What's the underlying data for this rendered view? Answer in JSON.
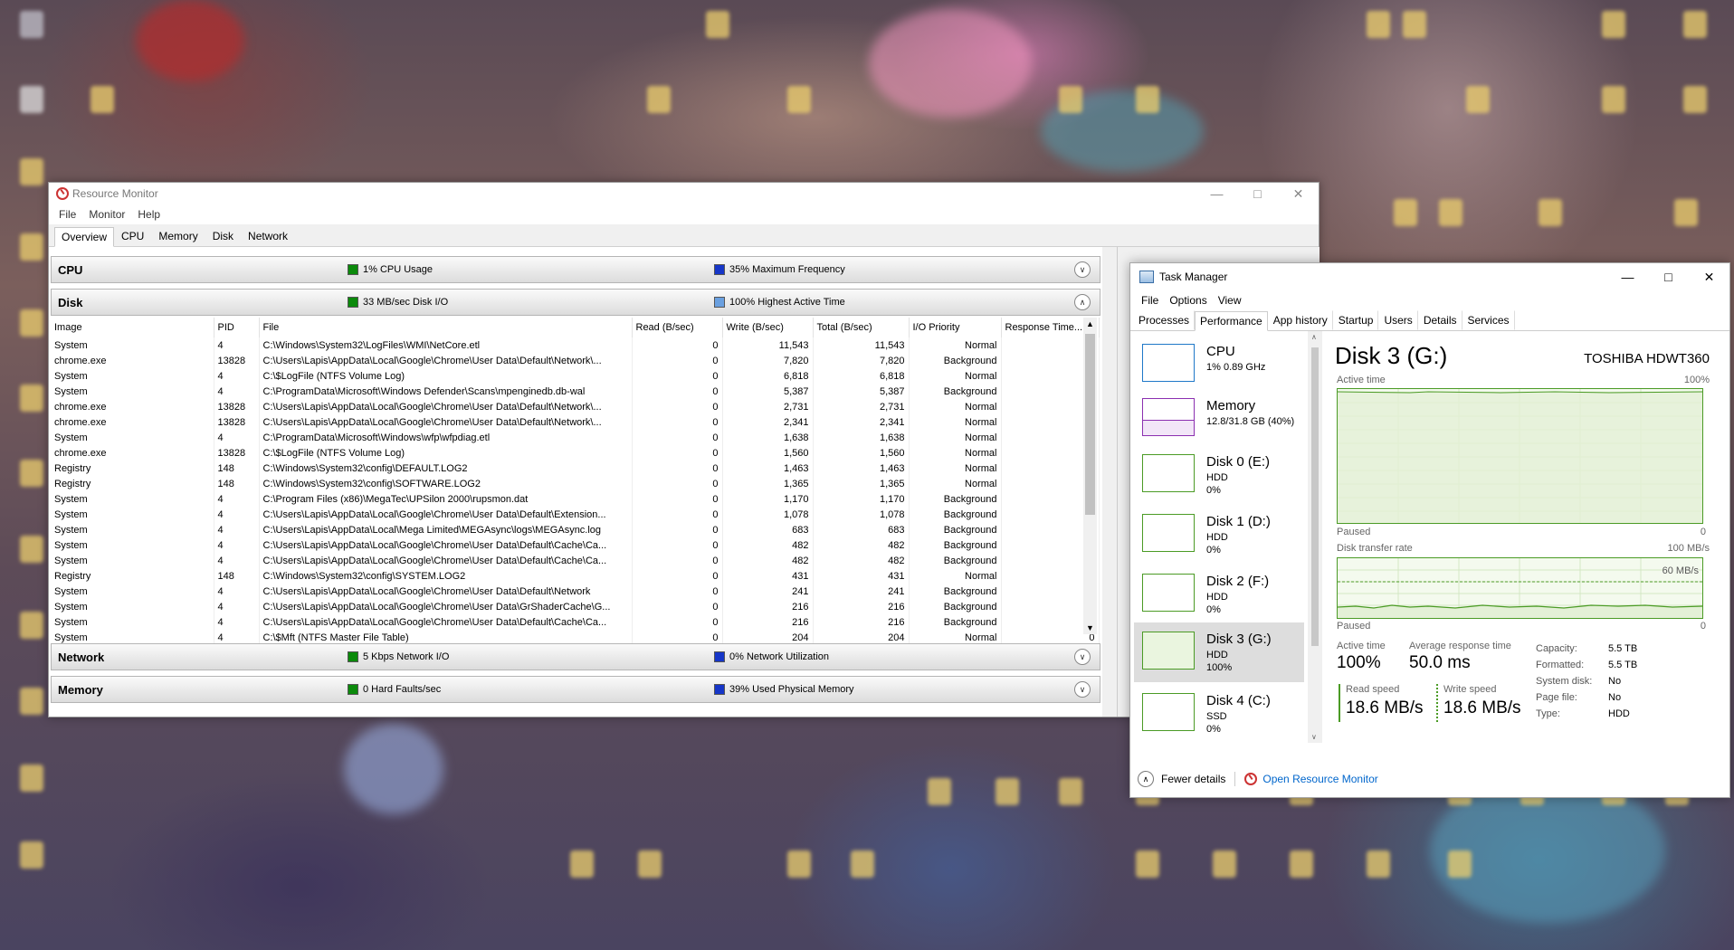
{
  "resmon": {
    "title": "Resource Monitor",
    "menu": [
      "File",
      "Monitor",
      "Help"
    ],
    "tabs": [
      "Overview",
      "CPU",
      "Memory",
      "Disk",
      "Network"
    ],
    "cpu": {
      "name": "CPU",
      "legend1": "1% CPU Usage",
      "legend2": "35% Maximum Frequency"
    },
    "disk": {
      "name": "Disk",
      "legend1": "33 MB/sec Disk I/O",
      "legend2": "100% Highest Active Time"
    },
    "network": {
      "name": "Network",
      "legend1": "5 Kbps Network I/O",
      "legend2": "0% Network Utilization"
    },
    "memory": {
      "name": "Memory",
      "legend1": "0 Hard Faults/sec",
      "legend2": "39% Used Physical Memory"
    },
    "disk_table": {
      "columns": [
        "Image",
        "PID",
        "File",
        "Read (B/sec)",
        "Write (B/sec)",
        "Total (B/sec)",
        "I/O Priority",
        "Response Time..."
      ],
      "rows": [
        [
          "System",
          "4",
          "C:\\Windows\\System32\\LogFiles\\WMI\\NetCore.etl",
          "0",
          "11,543",
          "11,543",
          "Normal",
          "0"
        ],
        [
          "chrome.exe",
          "13828",
          "C:\\Users\\Lapis\\AppData\\Local\\Google\\Chrome\\User Data\\Default\\Network\\...",
          "0",
          "7,820",
          "7,820",
          "Background",
          "0"
        ],
        [
          "System",
          "4",
          "C:\\$LogFile (NTFS Volume Log)",
          "0",
          "6,818",
          "6,818",
          "Normal",
          "0"
        ],
        [
          "System",
          "4",
          "C:\\ProgramData\\Microsoft\\Windows Defender\\Scans\\mpenginedb.db-wal",
          "0",
          "5,387",
          "5,387",
          "Background",
          "0"
        ],
        [
          "chrome.exe",
          "13828",
          "C:\\Users\\Lapis\\AppData\\Local\\Google\\Chrome\\User Data\\Default\\Network\\...",
          "0",
          "2,731",
          "2,731",
          "Normal",
          "0"
        ],
        [
          "chrome.exe",
          "13828",
          "C:\\Users\\Lapis\\AppData\\Local\\Google\\Chrome\\User Data\\Default\\Network\\...",
          "0",
          "2,341",
          "2,341",
          "Normal",
          "0"
        ],
        [
          "System",
          "4",
          "C:\\ProgramData\\Microsoft\\Windows\\wfp\\wfpdiag.etl",
          "0",
          "1,638",
          "1,638",
          "Normal",
          "0"
        ],
        [
          "chrome.exe",
          "13828",
          "C:\\$LogFile (NTFS Volume Log)",
          "0",
          "1,560",
          "1,560",
          "Normal",
          "0"
        ],
        [
          "Registry",
          "148",
          "C:\\Windows\\System32\\config\\DEFAULT.LOG2",
          "0",
          "1,463",
          "1,463",
          "Normal",
          "0"
        ],
        [
          "Registry",
          "148",
          "C:\\Windows\\System32\\config\\SOFTWARE.LOG2",
          "0",
          "1,365",
          "1,365",
          "Normal",
          "0"
        ],
        [
          "System",
          "4",
          "C:\\Program Files (x86)\\MegaTec\\UPSilon 2000\\rupsmon.dat",
          "0",
          "1,170",
          "1,170",
          "Background",
          "0"
        ],
        [
          "System",
          "4",
          "C:\\Users\\Lapis\\AppData\\Local\\Google\\Chrome\\User Data\\Default\\Extension...",
          "0",
          "1,078",
          "1,078",
          "Background",
          "0"
        ],
        [
          "System",
          "4",
          "C:\\Users\\Lapis\\AppData\\Local\\Mega Limited\\MEGAsync\\logs\\MEGAsync.log",
          "0",
          "683",
          "683",
          "Background",
          "1"
        ],
        [
          "System",
          "4",
          "C:\\Users\\Lapis\\AppData\\Local\\Google\\Chrome\\User Data\\Default\\Cache\\Ca...",
          "0",
          "482",
          "482",
          "Background",
          "0"
        ],
        [
          "System",
          "4",
          "C:\\Users\\Lapis\\AppData\\Local\\Google\\Chrome\\User Data\\Default\\Cache\\Ca...",
          "0",
          "482",
          "482",
          "Background",
          "0"
        ],
        [
          "Registry",
          "148",
          "C:\\Windows\\System32\\config\\SYSTEM.LOG2",
          "0",
          "431",
          "431",
          "Normal",
          "0"
        ],
        [
          "System",
          "4",
          "C:\\Users\\Lapis\\AppData\\Local\\Google\\Chrome\\User Data\\Default\\Network",
          "0",
          "241",
          "241",
          "Background",
          "0"
        ],
        [
          "System",
          "4",
          "C:\\Users\\Lapis\\AppData\\Local\\Google\\Chrome\\User Data\\GrShaderCache\\G...",
          "0",
          "216",
          "216",
          "Background",
          "0"
        ],
        [
          "System",
          "4",
          "C:\\Users\\Lapis\\AppData\\Local\\Google\\Chrome\\User Data\\Default\\Cache\\Ca...",
          "0",
          "216",
          "216",
          "Background",
          "0"
        ],
        [
          "System",
          "4",
          "C:\\$Mft (NTFS Master File Table)",
          "0",
          "204",
          "204",
          "Normal",
          "0"
        ]
      ]
    }
  },
  "taskmgr": {
    "title": "Task Manager",
    "menu": [
      "File",
      "Options",
      "View"
    ],
    "tabs": [
      "Processes",
      "Performance",
      "App history",
      "Startup",
      "Users",
      "Details",
      "Services"
    ],
    "items": [
      {
        "name": "CPU",
        "sub1": "1% 0.89 GHz",
        "sub2": ""
      },
      {
        "name": "Memory",
        "sub1": "12.8/31.8 GB (40%)",
        "sub2": ""
      },
      {
        "name": "Disk 0 (E:)",
        "sub1": "HDD",
        "sub2": "0%"
      },
      {
        "name": "Disk 1 (D:)",
        "sub1": "HDD",
        "sub2": "0%"
      },
      {
        "name": "Disk 2 (F:)",
        "sub1": "HDD",
        "sub2": "0%"
      },
      {
        "name": "Disk 3 (G:)",
        "sub1": "HDD",
        "sub2": "100%"
      },
      {
        "name": "Disk 4 (C:)",
        "sub1": "SSD",
        "sub2": "0%"
      }
    ],
    "detail": {
      "title": "Disk 3 (G:)",
      "model": "TOSHIBA HDWT360",
      "active_time_label": "Active time",
      "active_time_max": "100%",
      "paused1": "Paused",
      "zero1": "0",
      "transfer_label": "Disk transfer rate",
      "transfer_max": "100 MB/s",
      "transfer_line": "60 MB/s",
      "paused2": "Paused",
      "zero2": "0",
      "stats": {
        "active_time_lbl": "Active time",
        "active_time_val": "100%",
        "avg_resp_lbl": "Average response time",
        "avg_resp_val": "50.0 ms",
        "read_lbl": "Read speed",
        "read_val": "18.6 MB/s",
        "write_lbl": "Write speed",
        "write_val": "18.6 MB/s"
      },
      "props": [
        {
          "k": "Capacity:",
          "v": "5.5 TB"
        },
        {
          "k": "Formatted:",
          "v": "5.5 TB"
        },
        {
          "k": "System disk:",
          "v": "No"
        },
        {
          "k": "Page file:",
          "v": "No"
        },
        {
          "k": "Type:",
          "v": "HDD"
        }
      ]
    },
    "footer": {
      "fewer": "Fewer details",
      "open_resmon": "Open Resource Monitor"
    }
  }
}
